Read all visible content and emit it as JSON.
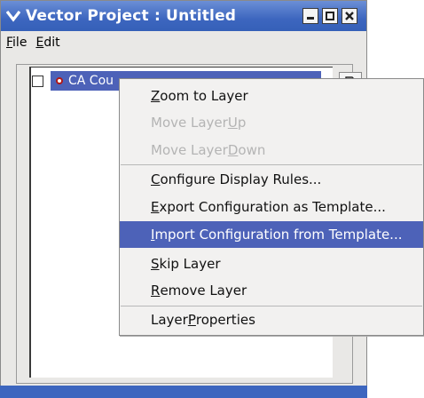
{
  "window": {
    "title": "Vector Project : Untitled"
  },
  "menubar": {
    "file": {
      "mnemonic": "F",
      "rest": "ile"
    },
    "edit": {
      "mnemonic": "E",
      "rest": "dit"
    }
  },
  "layer": {
    "label": "CA Cou",
    "selected": true,
    "checked": false
  },
  "context_menu": {
    "items": [
      {
        "pre": "",
        "mn": "Z",
        "post": "oom to Layer",
        "enabled": true,
        "highlighted": false
      },
      {
        "pre": "Move Layer ",
        "mn": "U",
        "post": "p",
        "enabled": false,
        "highlighted": false
      },
      {
        "pre": "Move Layer ",
        "mn": "D",
        "post": "own",
        "enabled": false,
        "highlighted": false
      },
      {
        "pre": "",
        "mn": "C",
        "post": "onfigure Display Rules...",
        "enabled": true,
        "highlighted": false
      },
      {
        "pre": "",
        "mn": "E",
        "post": "xport Configuration as Template...",
        "enabled": true,
        "highlighted": false
      },
      {
        "pre": "",
        "mn": "I",
        "post": "mport Configuration from Template...",
        "enabled": true,
        "highlighted": true
      },
      {
        "pre": "",
        "mn": "S",
        "post": "kip Layer",
        "enabled": true,
        "highlighted": false
      },
      {
        "pre": "",
        "mn": "R",
        "post": "emove Layer",
        "enabled": true,
        "highlighted": false
      },
      {
        "pre": "Layer ",
        "mn": "P",
        "post": "roperties",
        "enabled": true,
        "highlighted": false
      }
    ]
  },
  "colors": {
    "titlebar": "#3d66bf",
    "selection": "#4d62b8",
    "disabled_text": "#b4b4b4"
  },
  "icons": [
    "chevron-down-icon",
    "minimize-icon",
    "maximize-icon",
    "close-icon",
    "layer-dot-icon",
    "document-icon"
  ]
}
